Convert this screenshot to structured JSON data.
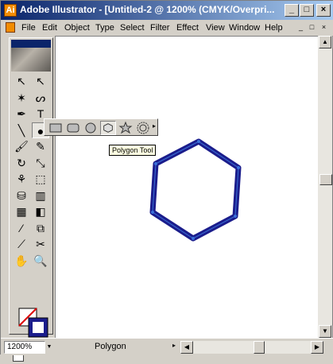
{
  "window": {
    "title": "Adobe Illustrator - [Untitled-2 @ 1200% (CMYK/Overpri...",
    "app_icon_glyph": "Ai",
    "controls": {
      "minimize": "_",
      "maximize": "□",
      "close": "×"
    }
  },
  "menubar": {
    "items": [
      "File",
      "Edit",
      "Object",
      "Type",
      "Select",
      "Filter",
      "Effect",
      "View",
      "Window",
      "Help"
    ],
    "doc_controls": {
      "minimize": "_",
      "restore": "□",
      "close": "×"
    }
  },
  "toolbox": {
    "tools": [
      {
        "name": "selection-tool",
        "glyph": "↖"
      },
      {
        "name": "direct-selection-tool",
        "glyph": "↖"
      },
      {
        "name": "magic-wand-tool",
        "glyph": "✶"
      },
      {
        "name": "lasso-tool",
        "glyph": "ᔕ"
      },
      {
        "name": "pen-tool",
        "glyph": "✒"
      },
      {
        "name": "type-tool",
        "glyph": "T"
      },
      {
        "name": "line-segment-tool",
        "glyph": "╲"
      },
      {
        "name": "shape-tool",
        "glyph": "●"
      },
      {
        "name": "paintbrush-tool",
        "glyph": "🖌"
      },
      {
        "name": "pencil-tool",
        "glyph": "✎"
      },
      {
        "name": "rotate-tool",
        "glyph": "↻"
      },
      {
        "name": "scale-tool",
        "glyph": "⤡"
      },
      {
        "name": "warp-tool",
        "glyph": "⚘"
      },
      {
        "name": "free-transform-tool",
        "glyph": "⬚"
      },
      {
        "name": "symbol-sprayer-tool",
        "glyph": "⛁"
      },
      {
        "name": "column-graph-tool",
        "glyph": "▥"
      },
      {
        "name": "mesh-tool",
        "glyph": "▦"
      },
      {
        "name": "gradient-tool",
        "glyph": "◧"
      },
      {
        "name": "eyedropper-tool",
        "glyph": "⁄"
      },
      {
        "name": "blend-tool",
        "glyph": "⧉"
      },
      {
        "name": "slice-tool",
        "glyph": "⟋"
      },
      {
        "name": "scissors-tool",
        "glyph": "✂"
      },
      {
        "name": "hand-tool",
        "glyph": "✋"
      },
      {
        "name": "zoom-tool",
        "glyph": "🔍"
      }
    ],
    "mode_buttons": [
      "▣",
      "◫",
      "⛶"
    ]
  },
  "flyout": {
    "tools": [
      {
        "name": "rectangle-tool",
        "selected": false
      },
      {
        "name": "rounded-rectangle-tool",
        "selected": false
      },
      {
        "name": "ellipse-tool",
        "selected": false
      },
      {
        "name": "polygon-tool",
        "selected": true
      },
      {
        "name": "star-tool",
        "selected": false
      },
      {
        "name": "flare-tool",
        "selected": false
      }
    ]
  },
  "tooltip": "Polygon Tool",
  "status": {
    "zoom": "1200%",
    "current_tool": "Polygon"
  },
  "colors": {
    "polygon_stroke": "#1b1d8c",
    "anchor_points": "#3a6fd8",
    "title_gradient_start": "#0a246a",
    "title_gradient_end": "#a6caf0",
    "accent_orange": "#f28c00"
  }
}
